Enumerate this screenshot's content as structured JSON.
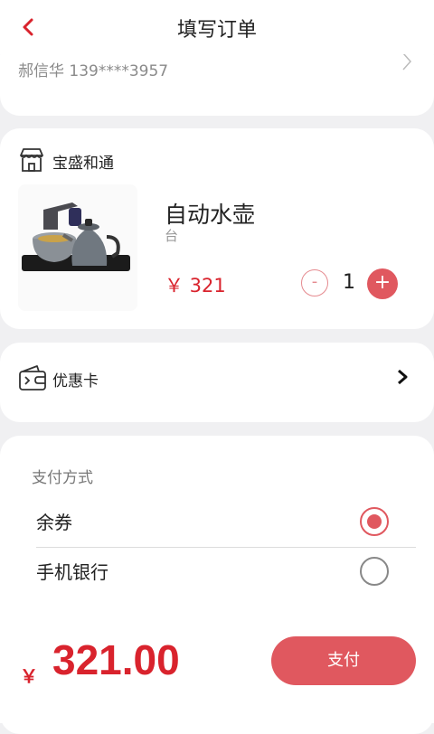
{
  "header": {
    "title": "填写订单",
    "back_icon": "chevron-left-icon"
  },
  "address": {
    "text": "郝信华 139****3957"
  },
  "shop": {
    "name": "宝盛和通",
    "product": {
      "name": "自动水壶",
      "unit": "台",
      "price": "￥ 321",
      "quantity": "1"
    },
    "minus_label": "-",
    "plus_label": "+"
  },
  "coupon": {
    "label": "优惠卡"
  },
  "payment": {
    "title": "支付方式",
    "options": [
      {
        "label": "余券",
        "selected": true
      },
      {
        "label": "手机银行",
        "selected": false
      }
    ]
  },
  "footer": {
    "currency": "￥",
    "total": "321.00",
    "pay_label": "支付"
  },
  "colors": {
    "accent": "#e0585f",
    "price": "#d9232d"
  }
}
